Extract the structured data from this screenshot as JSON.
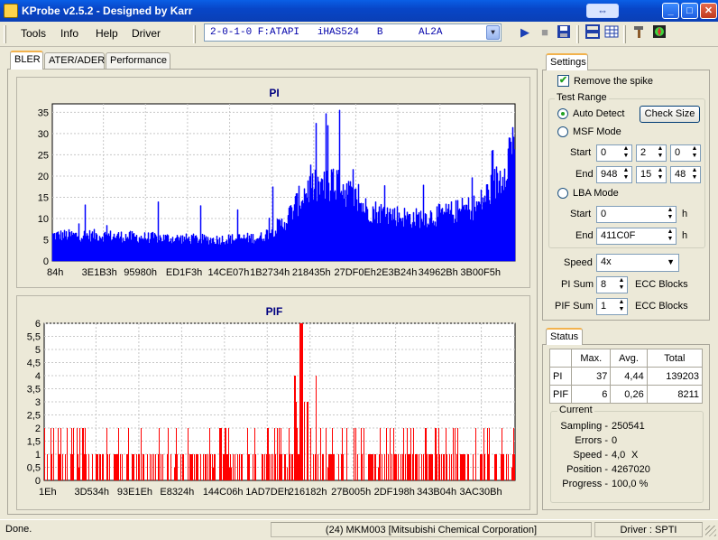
{
  "window": {
    "title": "KProbe v2.5.2 - Designed by Karr",
    "minimize": "_",
    "maximize": "□",
    "close": "✕",
    "restore": "⇔"
  },
  "menu": [
    "Tools",
    "Info",
    "Help",
    "Driver"
  ],
  "drive": {
    "selected": "2-0-1-0 F:ATAPI   iHAS524   B      AL2A"
  },
  "toolbar": {
    "play": "play-icon",
    "stop": "stop-icon",
    "save": "save-icon",
    "layout1": "split-layout-icon",
    "layout2": "table-layout-icon",
    "settings": "tools-icon",
    "about": "about-icon"
  },
  "tabs": [
    "BLER",
    "ATER/ADER",
    "Performance"
  ],
  "pi_chart": {
    "title": "PI",
    "yticks": [
      "0",
      "5",
      "10",
      "15",
      "20",
      "25",
      "30",
      "35"
    ],
    "xticks": [
      "84h",
      "3E1B3h",
      "95980h",
      "ED1F3h",
      "14CE07h",
      "1B2734h",
      "218435h",
      "27DF0Eh",
      "2E3B24h",
      "34962Bh",
      "3B00F5h"
    ]
  },
  "pif_chart": {
    "title": "PIF",
    "yticks": [
      "0",
      "0,5",
      "1",
      "1,5",
      "2",
      "2,5",
      "3",
      "3,5",
      "4",
      "4,5",
      "5",
      "5,5",
      "6"
    ],
    "xticks": [
      "1Eh",
      "3D534h",
      "93E1Eh",
      "E8324h",
      "144C06h",
      "1AD7DEh",
      "216182h",
      "27B005h",
      "2DF198h",
      "343B04h",
      "3AC30Bh"
    ]
  },
  "chart_data": [
    {
      "type": "bar",
      "title": "PI",
      "ylim": [
        0,
        37
      ],
      "color": "#0000ff",
      "note": "PI errors vs LBA; baseline ~5-8, rising to ~15-30 in the middle region and near end",
      "profile": [
        {
          "x": 0,
          "level": 6
        },
        {
          "x": 0.1,
          "level": 6
        },
        {
          "x": 0.2,
          "level": 5.5
        },
        {
          "x": 0.35,
          "level": 5
        },
        {
          "x": 0.45,
          "level": 5.5
        },
        {
          "x": 0.5,
          "level": 9
        },
        {
          "x": 0.55,
          "level": 17
        },
        {
          "x": 0.62,
          "level": 18
        },
        {
          "x": 0.68,
          "level": 12
        },
        {
          "x": 0.78,
          "level": 10
        },
        {
          "x": 0.85,
          "level": 11
        },
        {
          "x": 0.92,
          "level": 13
        },
        {
          "x": 0.97,
          "level": 20
        },
        {
          "x": 1,
          "level": 31
        }
      ],
      "stats": {
        "max": 37,
        "avg": 4.44,
        "total": 139203
      }
    },
    {
      "type": "bar",
      "title": "PIF",
      "ylim": [
        0,
        6
      ],
      "color": "#ff0000",
      "stats": {
        "max": 6,
        "avg": 0.26,
        "total": 8211
      }
    }
  ],
  "settings": {
    "title": "Settings",
    "remove_spike": "Remove the spike",
    "test_range": "Test Range",
    "auto_detect": "Auto Detect",
    "check_size": "Check Size",
    "msf_mode": "MSF Mode",
    "start_label": "Start",
    "end_label": "End",
    "msf_start": [
      "0",
      "2",
      "0"
    ],
    "msf_end": [
      "948",
      "15",
      "48"
    ],
    "lba_mode": "LBA Mode",
    "lba_start": "0",
    "lba_end": "411C0F",
    "h": "h",
    "speed_label": "Speed",
    "speed": "4x",
    "pi_sum_label": "PI Sum",
    "pi_sum": "8",
    "pif_sum_label": "PIF Sum",
    "pif_sum": "1",
    "ecc_blocks": "ECC Blocks"
  },
  "status": {
    "title": "Status",
    "headers": [
      "Max.",
      "Avg.",
      "Total"
    ],
    "rows": [
      {
        "label": "PI",
        "max": "37",
        "avg": "4,44",
        "total": "139203"
      },
      {
        "label": "PIF",
        "max": "6",
        "avg": "0,26",
        "total": "8211"
      }
    ],
    "current_title": "Current",
    "sampling_label": "Sampling -",
    "sampling": "250541",
    "errors_label": "Errors -",
    "errors": "0",
    "speed_label": "Speed -",
    "speed": "4,0",
    "speed_unit": "X",
    "position_label": "Position -",
    "position": "4267020",
    "progress_label": "Progress -",
    "progress": "100,0 %"
  },
  "statusbar": {
    "left": "Done.",
    "middle": "(24) MKM003 [Mitsubishi Chemical Corporation]",
    "right": "Driver : SPTI"
  }
}
